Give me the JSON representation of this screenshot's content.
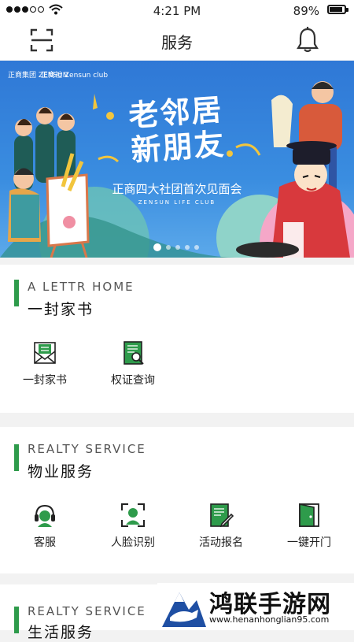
{
  "status_bar": {
    "time": "4:21 PM",
    "battery": "89%",
    "battery_level": 0.89
  },
  "header": {
    "title": "服务",
    "scan_icon": "scan-icon",
    "bell_icon": "bell-icon"
  },
  "banner": {
    "logo_left": "正商集团 ZENSUN",
    "logo_right": "正商社 Zensun club",
    "headline_1": "老邻居",
    "headline_2": "新朋友",
    "subline": "正商四大社团首次见面会",
    "eng": "ZENSUN LIFE CLUB",
    "slide_count": 5,
    "active_slide": 1
  },
  "sections": {
    "letter": {
      "en": "A LETTR HOME",
      "cn": "一封家书",
      "items": [
        {
          "label": "一封家书",
          "icon": "envelope-icon"
        },
        {
          "label": "权证查询",
          "icon": "document-search-icon"
        }
      ]
    },
    "property": {
      "en": "REALTY SERVICE",
      "cn": "物业服务",
      "items": [
        {
          "label": "客服",
          "icon": "headset-icon"
        },
        {
          "label": "人脸识别",
          "icon": "face-scan-icon"
        },
        {
          "label": "活动报名",
          "icon": "form-edit-icon"
        },
        {
          "label": "一键开门",
          "icon": "door-icon"
        }
      ]
    },
    "life": {
      "en": "REALTY SERVICE",
      "cn": "生活服务"
    }
  },
  "watermark": {
    "name": "鸿联手游网",
    "url": "www.henanhonglian95.com"
  },
  "colors": {
    "accent": "#2e9b4b",
    "banner": "#3a8de0"
  }
}
